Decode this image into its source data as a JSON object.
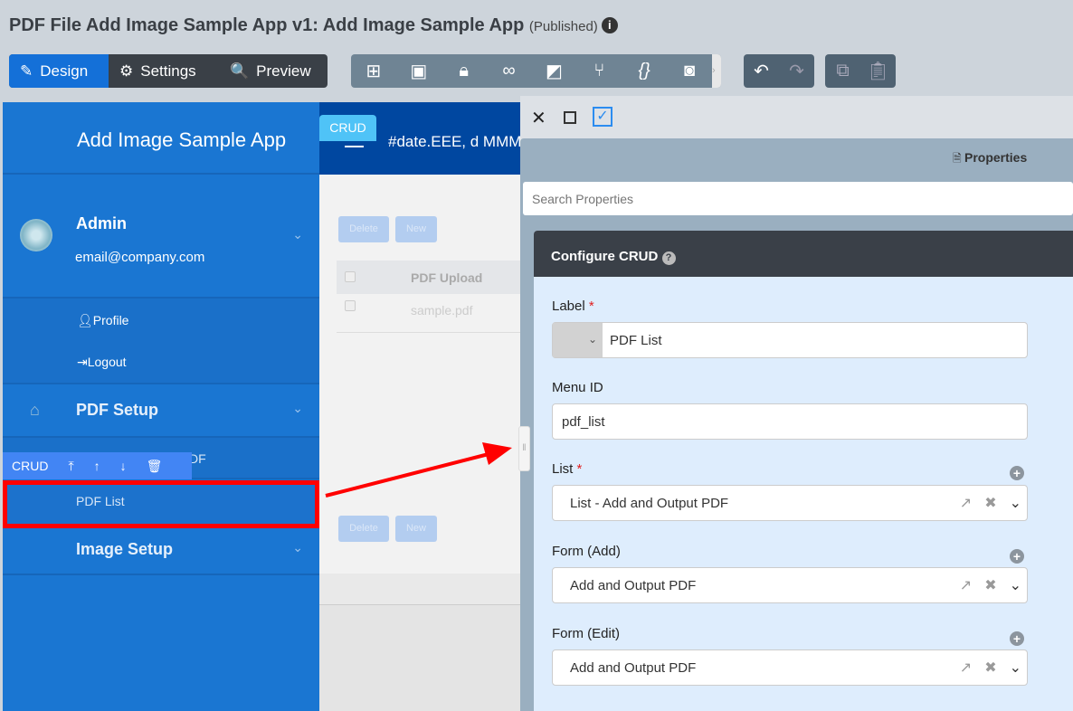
{
  "header": {
    "title": "PDF File Add Image Sample App v1: Add Image Sample App",
    "status": "(Published)"
  },
  "toolbar": {
    "design": "Design",
    "settings": "Settings",
    "preview": "Preview"
  },
  "sidebar": {
    "app_name": "Add Image Sample App",
    "user": "Admin",
    "email": "email@company.com",
    "profile": "Profile",
    "logout": "Logout",
    "pdf_setup": "PDF Setup",
    "hidden_item_fragment": "DF",
    "pdf_list": "PDF List",
    "image_setup": "Image Setup",
    "crud_tag": "CRUD"
  },
  "canvas": {
    "crud_tag": "CRUD",
    "date_text": "#date.EEE, d MMM",
    "delete": "Delete",
    "new": "New",
    "column": "PDF Upload",
    "row": "sample.pdf"
  },
  "properties": {
    "tab": "Properties",
    "search_placeholder": "Search Properties",
    "section": "Configure CRUD",
    "label_label": "Label",
    "label_value": "PDF List",
    "menu_id_label": "Menu ID",
    "menu_id_value": "pdf_list",
    "list_label": "List",
    "list_value": "List - Add and Output PDF",
    "form_add_label": "Form (Add)",
    "form_add_value": "Add and Output PDF",
    "form_edit_label": "Form (Edit)",
    "form_edit_value": "Add and Output PDF"
  },
  "colors": {
    "accent": "#1470d8",
    "sidebar": "#1a76d2",
    "highlight": "#ff0000"
  }
}
